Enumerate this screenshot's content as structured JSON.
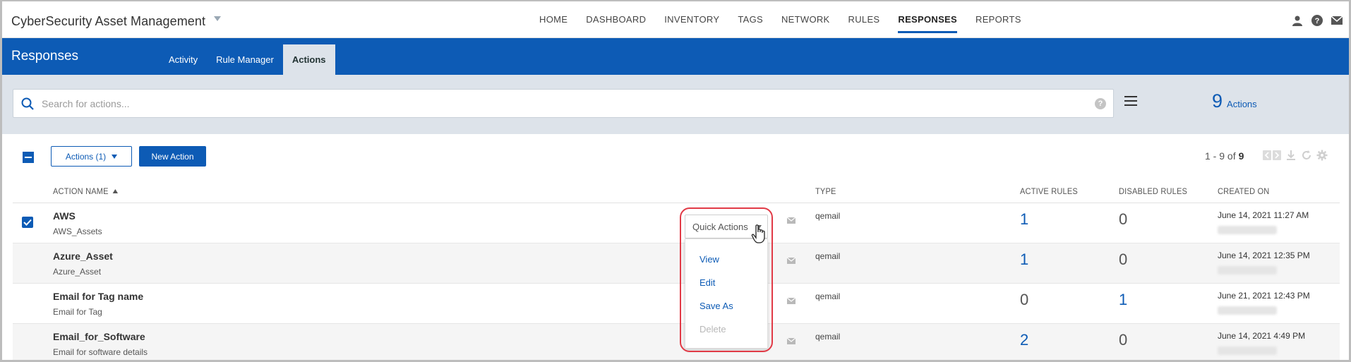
{
  "app": {
    "title": "CyberSecurity Asset Management"
  },
  "nav": {
    "items": [
      "HOME",
      "DASHBOARD",
      "INVENTORY",
      "TAGS",
      "NETWORK",
      "RULES",
      "RESPONSES",
      "REPORTS"
    ],
    "active": "RESPONSES"
  },
  "header": {
    "section_title": "Responses",
    "tabs": [
      "Activity",
      "Rule Manager",
      "Actions"
    ],
    "active_tab": "Actions"
  },
  "search": {
    "placeholder": "Search for actions...",
    "help": "?"
  },
  "summary": {
    "count": "9",
    "count_label": "Actions"
  },
  "toolbar": {
    "actions_button": "Actions (1)",
    "new_action_button": "New Action",
    "pagination_range": "1 - 9 of",
    "pagination_total": "9"
  },
  "table": {
    "columns": {
      "name": "ACTION NAME",
      "type": "TYPE",
      "active_rules": "ACTIVE RULES",
      "disabled_rules": "DISABLED RULES",
      "created_on": "CREATED ON"
    },
    "rows": [
      {
        "name": "AWS",
        "description": "AWS_Assets",
        "type": "qemail",
        "active_rules": "1",
        "disabled_rules": "0",
        "created_on": "June 14, 2021 11:27 AM",
        "checked": true
      },
      {
        "name": "Azure_Asset",
        "description": "Azure_Asset",
        "type": "qemail",
        "active_rules": "1",
        "disabled_rules": "0",
        "created_on": "June 14, 2021 12:35 PM",
        "checked": false
      },
      {
        "name": "Email for Tag name",
        "description": "Email for Tag",
        "type": "qemail",
        "active_rules": "0",
        "disabled_rules": "1",
        "created_on": "June 21, 2021 12:43 PM",
        "checked": false
      },
      {
        "name": "Email_for_Software",
        "description": "Email for software details",
        "type": "qemail",
        "active_rules": "2",
        "disabled_rules": "0",
        "created_on": "June 14, 2021 4:49 PM",
        "checked": false
      }
    ]
  },
  "quick_actions": {
    "label": "Quick Actions",
    "items": [
      "View",
      "Edit",
      "Save As",
      "Delete"
    ],
    "disabled_items": [
      "Delete"
    ]
  },
  "colors": {
    "brand_blue": "#0d5bb5",
    "highlight_red": "#e13a46",
    "search_band": "#dde3ea"
  }
}
